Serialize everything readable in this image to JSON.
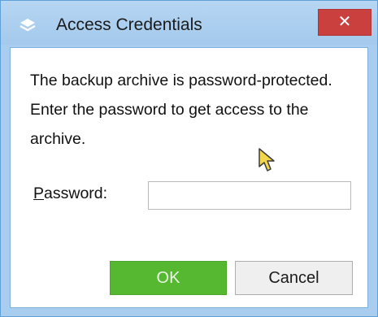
{
  "window": {
    "title": "Access Credentials",
    "close_label": "✕"
  },
  "dialog": {
    "message": "The backup archive is password-protected. Enter the password to get access to the archive.",
    "password_label_accel": "P",
    "password_label_rest": "assword:",
    "password_value": "",
    "ok_label": "OK",
    "cancel_label": "Cancel"
  },
  "icons": {
    "app": "layers-icon",
    "close": "close-icon",
    "cursor": "mouse-pointer-icon"
  },
  "colors": {
    "titlebar": "#a9cdee",
    "close_button": "#c9403f",
    "ok_button": "#55b830",
    "cancel_button": "#efefef"
  }
}
